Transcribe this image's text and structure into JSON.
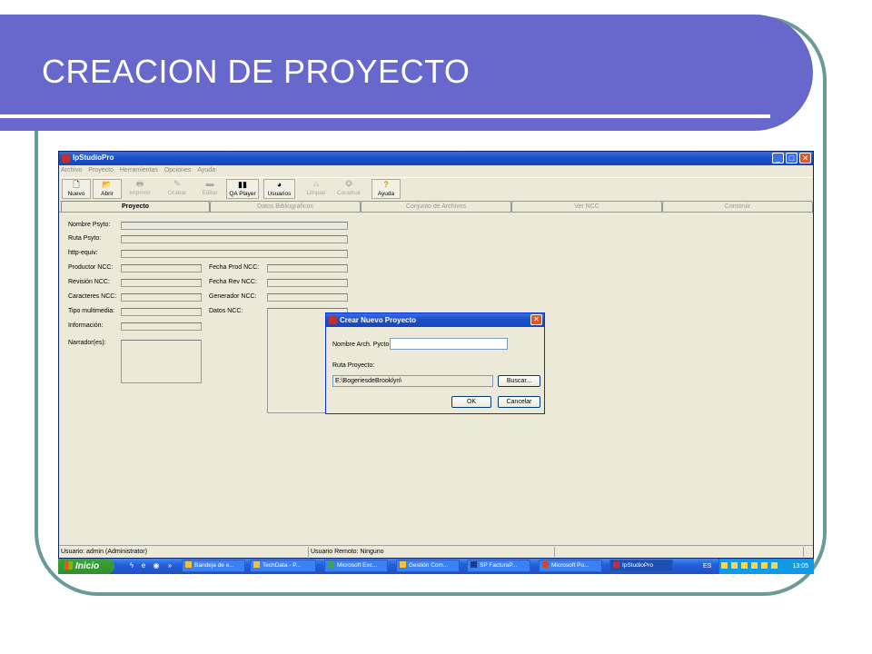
{
  "slide": {
    "title": "CREACION  DE PROYECTO"
  },
  "window": {
    "title": "IpStudioPro",
    "controls": {
      "minimize": "_",
      "maximize": "□",
      "close": "✕"
    },
    "menu": [
      "Archivo",
      "Proyecto",
      "Herramientas",
      "Opciones",
      "Ayuda"
    ],
    "toolbar": [
      {
        "label": "Nuevo",
        "icon": "new-document-icon",
        "glyph": "🗋",
        "enabled": true
      },
      {
        "label": "Abrir",
        "icon": "open-folder-icon",
        "glyph": "📂",
        "enabled": true
      },
      {
        "label": "Imprimir",
        "icon": "printer-icon",
        "glyph": "🖶",
        "enabled": false
      },
      {
        "label": "Grabar",
        "icon": "record-icon",
        "glyph": "✎",
        "enabled": false
      },
      {
        "label": "Editar",
        "icon": "edit-icon",
        "glyph": "▬",
        "enabled": false
      },
      {
        "label": "QA Player",
        "icon": "qa-player-icon",
        "glyph": "▮▮",
        "enabled": true
      },
      {
        "label": "Usuarios",
        "icon": "users-icon",
        "glyph": "◕",
        "enabled": true
      },
      {
        "label": "Limpiar",
        "icon": "clean-icon",
        "glyph": "♨",
        "enabled": false
      },
      {
        "label": "Construir",
        "icon": "build-icon",
        "glyph": "❂",
        "enabled": false
      },
      {
        "label": "Ayuda",
        "icon": "help-icon",
        "glyph": "?",
        "enabled": true
      }
    ],
    "tabs": [
      "Proyecto",
      "Datos Bibliográficos",
      "Conjunto de Archivos",
      "Ver NCC",
      "Construir"
    ],
    "active_tab": "Proyecto",
    "form": {
      "nombre_psyto": "Nombre Psyto:",
      "ruta_psyto": "Ruta Psyto:",
      "http_equiv": "http-equiv:",
      "productor_ncc": "Productor NCC:",
      "revision_ncc": "Revisión NCC:",
      "caracteres_ncc": "Caracteres NCC:",
      "tipo_multimedia": "Tipo multimedia:",
      "informacion": "Información:",
      "narradores": "Narrador(es):",
      "fecha_prod_ncc": "Fecha Prod NCC:",
      "fecha_rev_ncc": "Fecha Rev NCC:",
      "generador_ncc": "Generador NCC:",
      "datos_ncc": "Datos NCC:"
    },
    "status": {
      "usuario": "Usuario: admin (Administrator)",
      "usuario_remoto": "Usuario Remoto: Ninguno"
    }
  },
  "dialog": {
    "title": "Crear Nuevo Proyecto",
    "close": "✕",
    "nombre_label": "Nombre Arch. Pycto",
    "nombre_value": "",
    "ruta_label": "Ruta Proyecto:",
    "ruta_value": "E:\\BogeriesdeBrooklyn\\",
    "buscar": "Buscar...",
    "ok": "OK",
    "cancelar": "Cancelar"
  },
  "taskbar": {
    "start": "Inicio",
    "quick_launch": [
      "ϟ",
      "e",
      "◉",
      "»"
    ],
    "tasks": [
      {
        "label": "Bandeja de e...",
        "icon": "mail-icon"
      },
      {
        "label": "TechData - P...",
        "icon": "document-icon"
      },
      {
        "label": "Microsoft Exc...",
        "icon": "excel-icon"
      },
      {
        "label": "Gestión  Com...",
        "icon": "app-icon"
      },
      {
        "label": "SP FacturaP...",
        "icon": "app-icon"
      },
      {
        "label": "Microsoft Po...",
        "icon": "powerpoint-icon"
      },
      {
        "label": "IpStudioPro",
        "icon": "ipstudio-icon"
      }
    ],
    "language": "ES",
    "clock": "13:05"
  }
}
